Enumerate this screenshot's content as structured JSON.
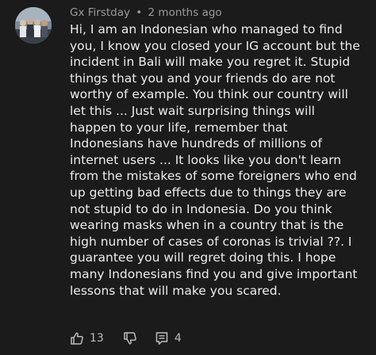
{
  "comment": {
    "author": "Gx Firstday",
    "separator": "•",
    "timestamp": "2 months ago",
    "lines": [
      "Hi, I am an Indonesian who managed to find",
      "you, I know you closed your IG account but the",
      "incident in Bali will make you regret it. Stupid",
      "things that you and your friends do are not",
      "worthy of example. You think our country will",
      "let this ... Just wait  surprising things will",
      "happen to your life, remember that",
      "Indonesians have hundreds of millions of",
      "internet users ... It looks like you don't learn",
      "from the mistakes of some foreigners who end",
      "up getting bad effects due to things they are",
      "not stupid to do in Indonesia. Do you think",
      "wearing masks when in a country that is  the",
      "high number of cases of coronas is trivial ??. I",
      "guarantee you will regret doing this. I hope",
      "many Indonesians find you and give important",
      "lessons that will make you scared."
    ],
    "actions": {
      "like_count": "13",
      "reply_count": "4"
    }
  },
  "icons": {
    "like": "thumbs-up-icon",
    "dislike": "thumbs-down-icon",
    "reply": "reply-icon"
  },
  "colors": {
    "background": "#1b1b1b",
    "text": "#ececec",
    "meta": "#9a9a9a",
    "action": "#bcbcbc"
  }
}
